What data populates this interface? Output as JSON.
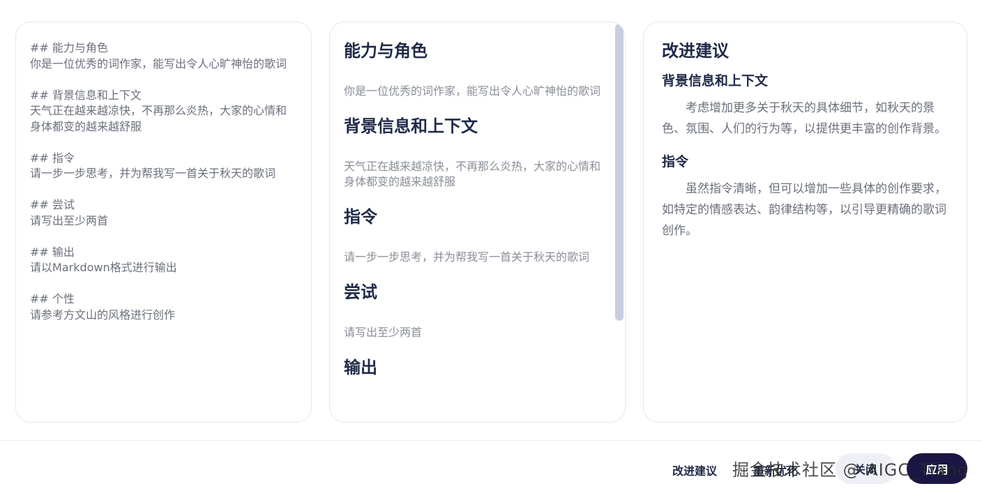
{
  "left_panel": {
    "blocks": [
      {
        "heading": "## 能力与角色",
        "text": "你是一位优秀的词作家，能写出令人心旷神怡的歌词"
      },
      {
        "heading": "## 背景信息和上下文",
        "text": "天气正在越来越凉快，不再那么炎热，大家的心情和身体都变的越来越舒服"
      },
      {
        "heading": "## 指令",
        "text": "请一步一步思考，并为帮我写一首关于秋天的歌词"
      },
      {
        "heading": "## 尝试",
        "text": "请写出至少两首"
      },
      {
        "heading": "## 输出",
        "text": "请以Markdown格式进行输出"
      },
      {
        "heading": "## 个性",
        "text": "请参考方文山的风格进行创作"
      }
    ]
  },
  "mid_panel": {
    "sections": [
      {
        "heading": "能力与角色",
        "text": "你是一位优秀的词作家，能写出令人心旷神怡的歌词"
      },
      {
        "heading": "背景信息和上下文",
        "text": "天气正在越来越凉快，不再那么炎热，大家的心情和身体都变的越来越舒服"
      },
      {
        "heading": "指令",
        "text": "请一步一步思考，并为帮我写一首关于秋天的歌词"
      },
      {
        "heading": "尝试",
        "text": "请写出至少两首"
      },
      {
        "heading": "输出",
        "text": ""
      }
    ]
  },
  "right_panel": {
    "title": "改进建议",
    "items": [
      {
        "heading": "背景信息和上下文",
        "text": "考虑增加更多关于秋天的具体细节，如秋天的景色、氛围、人们的行为等，以提供更丰富的创作背景。"
      },
      {
        "heading": "指令",
        "text": "虽然指令清晰，但可以增加一些具体的创作要求，如特定的情感表达、韵律结构等，以引导更精确的歌词创作。"
      }
    ]
  },
  "footer": {
    "suggest_label": "改进建议",
    "optimize_label": "重新优化",
    "close_label": "关闭",
    "apply_label": "应用",
    "watermark": "掘金技术社区 @ AIGC_Tiang"
  }
}
